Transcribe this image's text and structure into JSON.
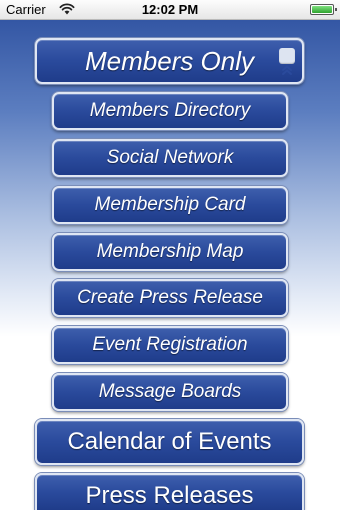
{
  "status_bar": {
    "carrier": "Carrier",
    "time": "12:02 PM",
    "battery_level": 1.0
  },
  "menu": {
    "section": {
      "label": "Members Only",
      "collapse_icon": "chevron-double-up-icon"
    },
    "items": [
      {
        "label": "Members Directory"
      },
      {
        "label": "Social Network"
      },
      {
        "label": "Membership Card"
      },
      {
        "label": "Membership Map"
      },
      {
        "label": "Create Press Release"
      },
      {
        "label": "Event Registration"
      },
      {
        "label": "Message Boards"
      }
    ],
    "main_items": [
      {
        "label": "Calendar of Events"
      },
      {
        "label": "Press Releases"
      }
    ]
  },
  "colors": {
    "button_blue": "#2a4a9c",
    "button_border": "#dfe6f3",
    "background_top": "#2b4e9e"
  }
}
